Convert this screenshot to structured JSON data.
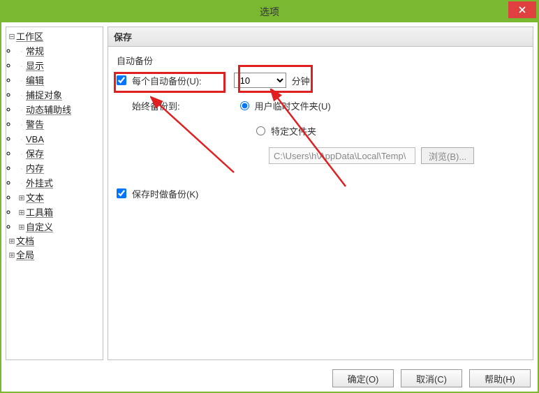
{
  "titlebar": {
    "title": "选项"
  },
  "sidebar": {
    "items": [
      {
        "label": "工作区",
        "children": [
          "常规",
          "显示",
          "编辑",
          "捕捉对象",
          "动态辅助线",
          "警告",
          "VBA",
          "保存",
          "内存",
          "外挂式",
          "文本",
          "工具箱",
          "自定义"
        ],
        "childHasExpander": [
          false,
          false,
          false,
          false,
          false,
          false,
          false,
          false,
          false,
          false,
          true,
          true,
          true
        ]
      },
      {
        "label": "文档"
      },
      {
        "label": "全局"
      }
    ]
  },
  "content": {
    "header": "保存",
    "section_autobackup": "自动备份",
    "autobackup_check_label": "每个自动备份(U):",
    "interval_value": "10",
    "interval_unit": "分钟",
    "always_backup_to": "始终备份到:",
    "radio_user_temp": "用户临时文件夹(U)",
    "radio_specific": "特定文件夹",
    "path_value": "C:\\Users\\h\\AppData\\Local\\Temp\\",
    "browse_label": "浏览(B)...",
    "backup_on_save_label": "保存时做备份(K)"
  },
  "footer": {
    "ok": "确定(O)",
    "cancel": "取消(C)",
    "help": "帮助(H)"
  }
}
